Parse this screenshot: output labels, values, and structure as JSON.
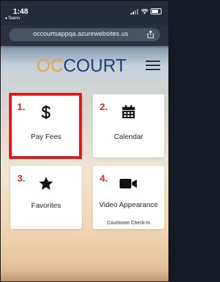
{
  "status_bar": {
    "time": "1:48",
    "back_app": "◂ Teams"
  },
  "browser": {
    "url": "occourtsappqa.azurewebsites.us"
  },
  "logo": {
    "part1": "OC",
    "part2": "COURT"
  },
  "tiles": [
    {
      "number": "1.",
      "label": "Pay Fees",
      "icon": "dollar-icon"
    },
    {
      "number": "2.",
      "label": "Calendar",
      "icon": "calendar-icon"
    },
    {
      "number": "3.",
      "label": "Favorites",
      "icon": "star-icon"
    },
    {
      "number": "4.",
      "label": "Video Appearance",
      "sublabel": "Courtroom Check-In",
      "icon": "video-camera-icon"
    }
  ],
  "colors": {
    "logo_orange": "#f3a33a",
    "logo_blue": "#1d3f7a",
    "number_red": "#e02424",
    "highlight_red": "#e8141a"
  }
}
